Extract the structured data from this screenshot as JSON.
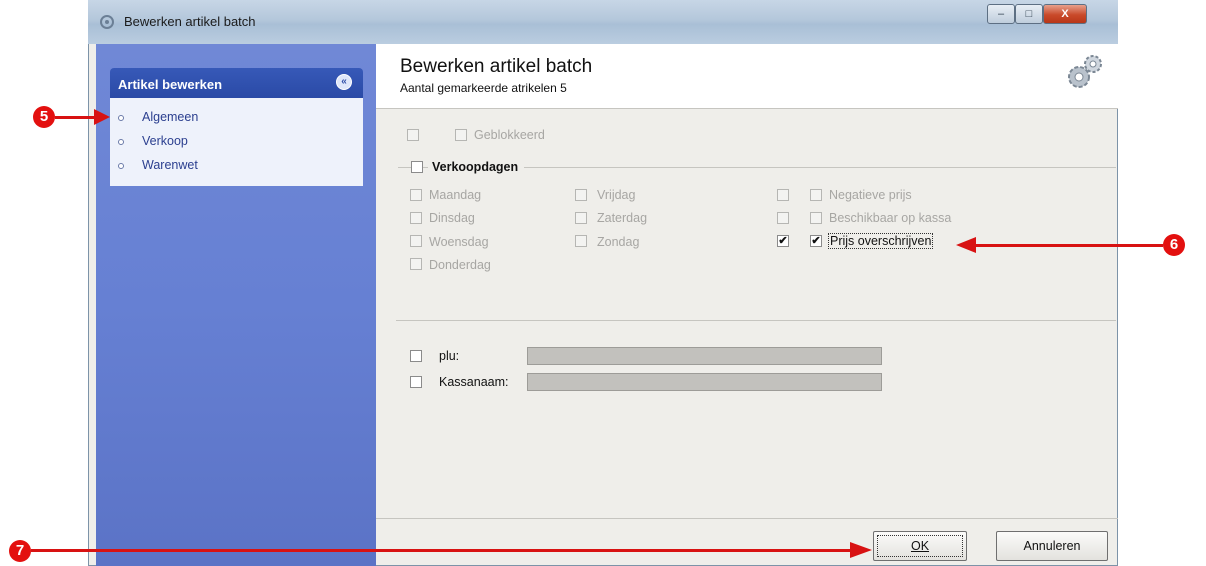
{
  "window": {
    "title": "Bewerken artikel batch",
    "controls": {
      "minimize": "–",
      "maximize": "□",
      "close": "X"
    }
  },
  "sidebar": {
    "panel_title": "Artikel bewerken",
    "collapse_glyph": "«",
    "items": [
      {
        "label": "Algemeen"
      },
      {
        "label": "Verkoop"
      },
      {
        "label": "Warenwet"
      }
    ]
  },
  "main": {
    "title": "Bewerken artikel batch",
    "subtitle": "Aantal gemarkeerde atrikelen 5",
    "geblokkeerd_label": "Geblokkeerd",
    "verkoopdagen_label": "Verkoopdagen",
    "days": [
      {
        "label": "Maandag"
      },
      {
        "label": "Dinsdag"
      },
      {
        "label": "Woensdag"
      },
      {
        "label": "Donderdag"
      },
      {
        "label": "Vrijdag"
      },
      {
        "label": "Zaterdag"
      },
      {
        "label": "Zondag"
      }
    ],
    "options": [
      {
        "label": "Negatieve prijs",
        "checked": false
      },
      {
        "label": "Beschikbaar op kassa",
        "checked": false
      },
      {
        "label": "Prijs overschrijven",
        "checked": true
      }
    ],
    "check_glyph": "✔",
    "fields": [
      {
        "label": "plu:",
        "value": ""
      },
      {
        "label": "Kassanaam:",
        "value": ""
      }
    ]
  },
  "buttons": {
    "ok": "OK",
    "cancel": "Annuleren"
  },
  "annotations": [
    {
      "number": "5"
    },
    {
      "number": "6"
    },
    {
      "number": "7"
    }
  ],
  "colors": {
    "sidebar": "#6680d3",
    "sidebar_header": "#2a4aa6",
    "annotation": "#e3100f"
  }
}
